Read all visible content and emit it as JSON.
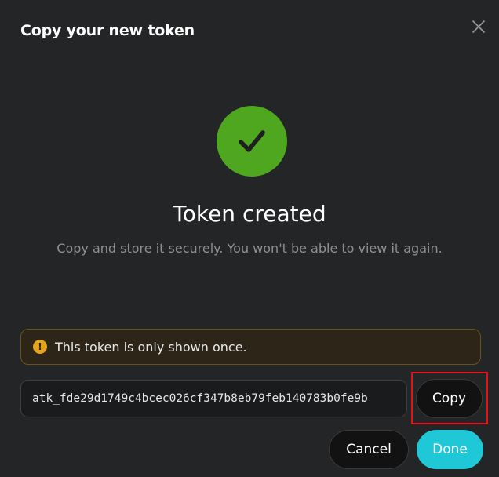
{
  "dialog": {
    "title": "Copy your new token",
    "close_icon": "close-icon"
  },
  "status": {
    "icon": "checkmark-icon",
    "icon_color": "#4fa720",
    "heading": "Token created",
    "message": "Copy and store it securely. You won't be able to view it again."
  },
  "warning": {
    "icon": "warning-icon",
    "color": "#e5a21c",
    "text": "This token is only shown once."
  },
  "token": {
    "value": "atk_fde29d1749c4bcec026cf347b8eb79feb140783b0fe9b"
  },
  "actions": {
    "copy_label": "Copy",
    "cancel_label": "Cancel",
    "done_label": "Done",
    "accent_color": "#1ec8d6"
  }
}
